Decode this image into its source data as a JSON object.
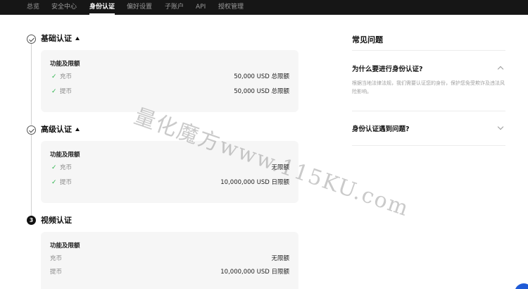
{
  "nav": {
    "items": [
      {
        "label": "总览",
        "active": false
      },
      {
        "label": "安全中心",
        "active": false
      },
      {
        "label": "身份认证",
        "active": true
      },
      {
        "label": "偏好设置",
        "active": false
      },
      {
        "label": "子账户",
        "active": false
      },
      {
        "label": "API",
        "active": false
      },
      {
        "label": "授权管理",
        "active": false
      }
    ]
  },
  "sections": [
    {
      "step": "done",
      "title": "基础认证",
      "expanded": true,
      "card_title": "功能及限额",
      "rows": [
        {
          "label": "充币",
          "value": "50,000 USD 总限额",
          "checked": true
        },
        {
          "label": "提币",
          "value": "50,000 USD 总限额",
          "checked": true
        }
      ]
    },
    {
      "step": "done",
      "title": "高级认证",
      "expanded": true,
      "card_title": "功能及限额",
      "rows": [
        {
          "label": "充币",
          "value": "无限额",
          "checked": true
        },
        {
          "label": "提币",
          "value": "10,000,000 USD 日限额",
          "checked": true
        }
      ]
    },
    {
      "step": "3",
      "title": "视频认证",
      "expanded": false,
      "card_title": "功能及限额",
      "rows": [
        {
          "label": "充币",
          "value": "无限额",
          "checked": false
        },
        {
          "label": "提币",
          "value": "10,000,000 USD 日限额",
          "checked": false
        }
      ]
    }
  ],
  "faq": {
    "title": "常见问题",
    "items": [
      {
        "question": "为什么要进行身份认证?",
        "answer": "根据当地法律法规，我们需要认证您的身份，保护您免受欺诈及违法风险影响。",
        "expanded": true
      },
      {
        "question": "身份认证遇到问题?",
        "answer": "",
        "expanded": false
      }
    ]
  },
  "watermark": {
    "text": "量化魔方www.115KU.com"
  },
  "icons": {
    "check": "check-icon",
    "step_done": "check-circle-icon",
    "caret": "caret-up-icon",
    "chevron": "chevron-icon"
  },
  "colors": {
    "nav_bg": "#161616",
    "check_green": "#2db44d",
    "card_bg": "#f6f6f6",
    "step_number_bg": "#111111",
    "help_blue": "#1f5bd6"
  }
}
